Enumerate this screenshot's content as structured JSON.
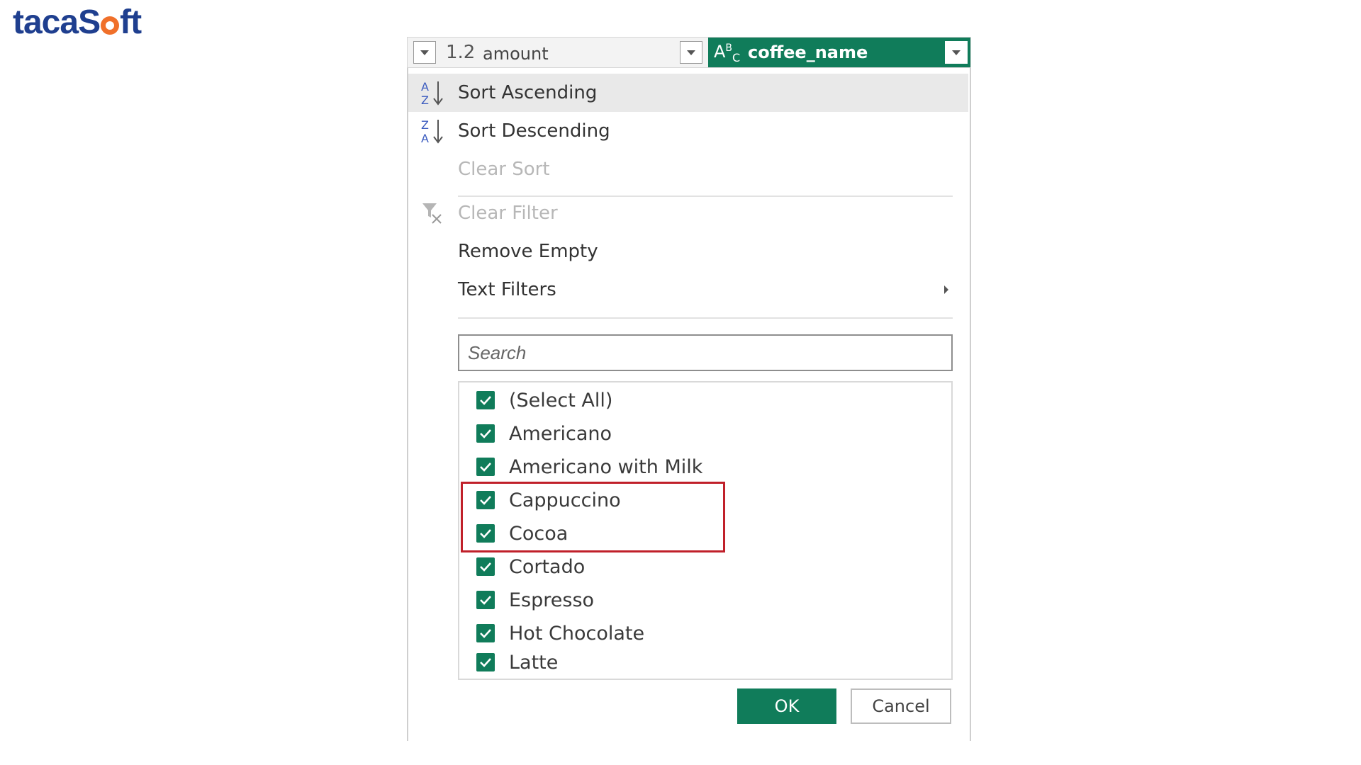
{
  "brand": {
    "logo_text_before": "taca",
    "logo_text_after": "S",
    "logo_text_end": "ft"
  },
  "header": {
    "columns": [
      {
        "type_label": "1.2",
        "name": "amount"
      },
      {
        "type_label": "ABC",
        "name": "coffee_name"
      }
    ]
  },
  "menu": {
    "sort_ascending": "Sort Ascending",
    "sort_descending": "Sort Descending",
    "clear_sort": "Clear Sort",
    "clear_filter": "Clear Filter",
    "remove_empty": "Remove Empty",
    "text_filters": "Text Filters"
  },
  "search": {
    "placeholder": "Search",
    "value": ""
  },
  "list": {
    "items": [
      {
        "label": "(Select All)",
        "checked": true
      },
      {
        "label": "Americano",
        "checked": true
      },
      {
        "label": "Americano with Milk",
        "checked": true
      },
      {
        "label": "Cappuccino",
        "checked": true
      },
      {
        "label": "Cocoa",
        "checked": true
      },
      {
        "label": "Cortado",
        "checked": true
      },
      {
        "label": "Espresso",
        "checked": true
      },
      {
        "label": "Hot Chocolate",
        "checked": true
      },
      {
        "label": "Latte",
        "checked": true
      }
    ]
  },
  "buttons": {
    "ok": "OK",
    "cancel": "Cancel"
  },
  "colors": {
    "accent": "#107c5a",
    "highlight": "#c0202a",
    "logo": "#1f3f8f",
    "logo_dot": "#f0702a"
  }
}
